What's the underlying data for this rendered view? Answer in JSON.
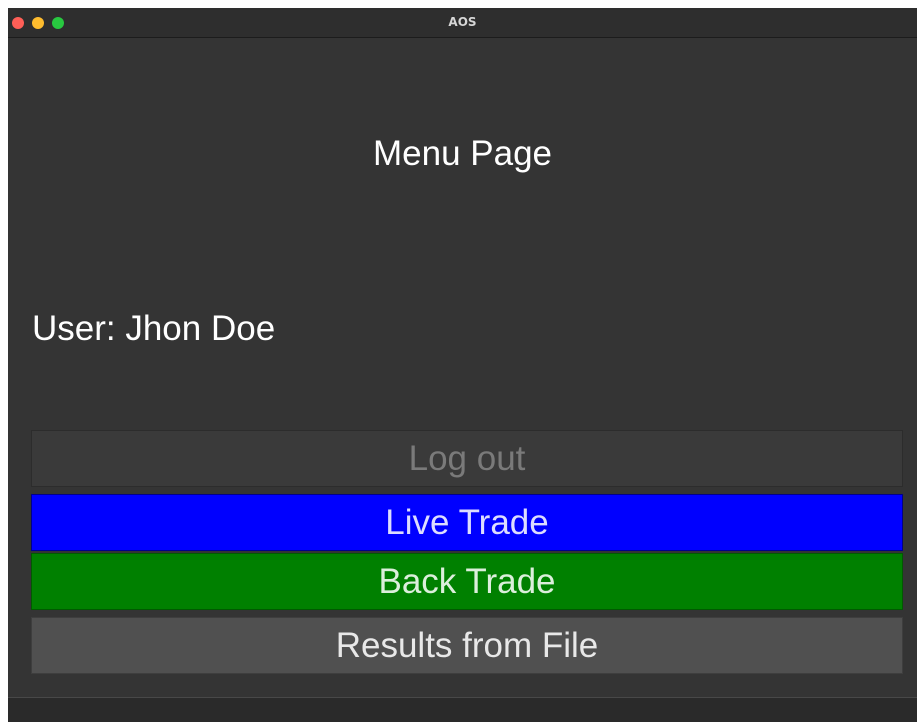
{
  "window": {
    "title": "AOS"
  },
  "main": {
    "page_title": "Menu Page",
    "user_label": "User: Jhon Doe"
  },
  "buttons": {
    "logout": "Log out",
    "live_trade": "Live Trade",
    "back_trade": "Back Trade",
    "results_from_file": "Results from File"
  },
  "colors": {
    "window_bg": "#343434",
    "live_trade": "#0000ff",
    "back_trade": "#008000",
    "results_from_file": "#505050",
    "logout_disabled": "#3a3a3a"
  },
  "icons": {
    "close": "close-traffic-light-icon",
    "minimize": "minimize-traffic-light-icon",
    "maximize": "maximize-traffic-light-icon"
  }
}
